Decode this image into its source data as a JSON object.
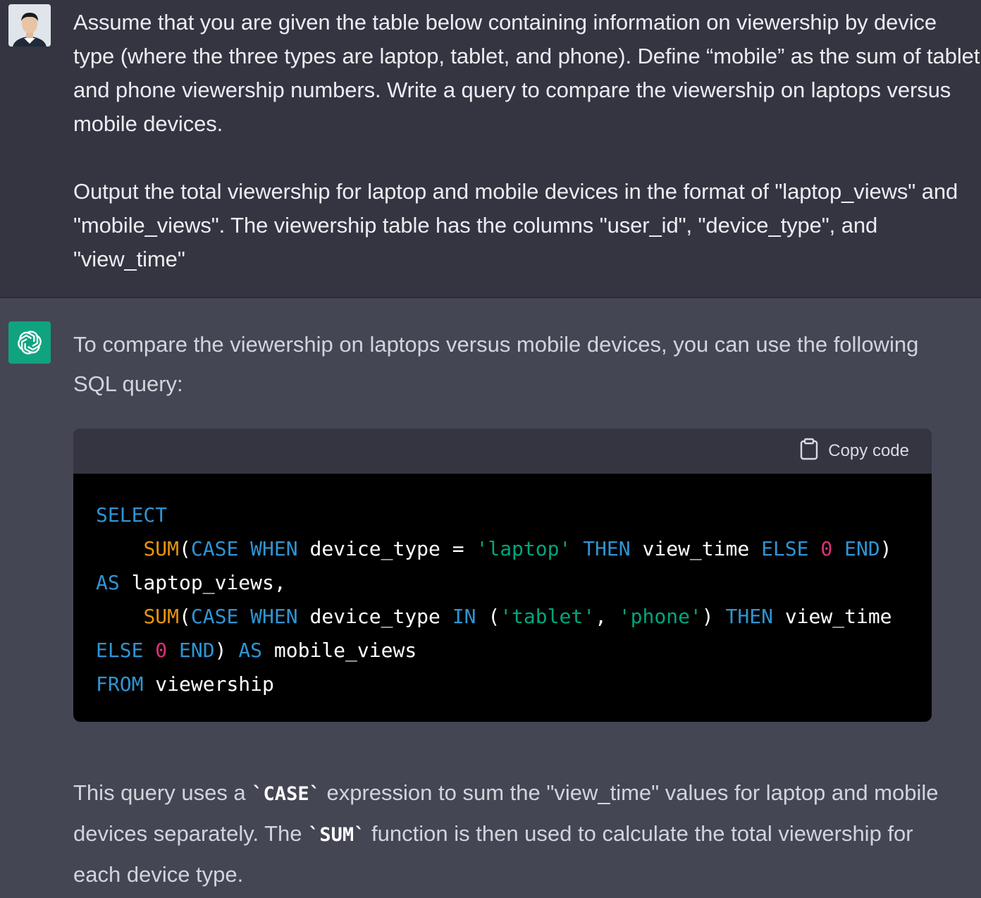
{
  "user": {
    "paragraph1": "Assume that you are given the table below containing information on viewership by device type (where the three types are laptop, tablet, and phone). Define “mobile” as the sum of tablet and phone viewership numbers. Write a query to compare the viewership on laptops versus mobile devices.",
    "paragraph2": "Output the total viewership for laptop and mobile devices in the format of \"laptop_views\" and \"mobile_views\". The viewership table has the columns \"user_id\", \"device_type\", and \"view_time\""
  },
  "assistant": {
    "intro": "To compare the viewership on laptops versus mobile devices, you can use the following SQL query:",
    "copy_label": "Copy code",
    "code": {
      "select": "SELECT",
      "sum": "SUM",
      "case": "CASE",
      "when": "WHEN",
      "device_type": "device_type",
      "eq": "=",
      "laptop_str": "'laptop'",
      "then": "THEN",
      "view_time": "view_time",
      "else": "ELSE",
      "zero": "0",
      "end": "END",
      "as": "AS",
      "laptop_views": "laptop_views,",
      "in": "IN",
      "tablet_str": "'tablet'",
      "phone_str": "'phone'",
      "mobile_views": "mobile_views",
      "from": "FROM",
      "table": "viewership"
    },
    "outro_parts": {
      "p1": "This query uses a ",
      "case_code": "`CASE`",
      "p2": " expression to sum the \"view_time\" values for laptop and mobile devices separately. The ",
      "sum_code": "`SUM`",
      "p3": " function is then used to calculate the total viewership for each device type."
    }
  },
  "colors": {
    "user_bg": "#343541",
    "assistant_bg": "#444654",
    "accent": "#10a37f",
    "keyword": "#2e95d3",
    "string": "#00a67d",
    "number": "#df3079",
    "function": "#e9950c"
  }
}
